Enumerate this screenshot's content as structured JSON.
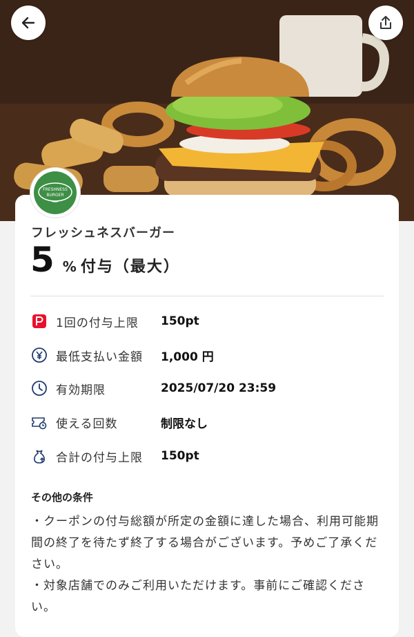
{
  "header": {
    "back_icon": "arrow-left-icon",
    "share_icon": "share-icon"
  },
  "shop": {
    "logo_text_line1": "FRESHNESS",
    "logo_text_line2": "BURGER",
    "name": "フレッシュネスバーガー"
  },
  "reward": {
    "rate": "5",
    "unit": "%",
    "text": "付与（最大）"
  },
  "details": [
    {
      "icon": "paypay-icon",
      "label": "1回の付与上限",
      "value": "150pt"
    },
    {
      "icon": "yen-icon",
      "label": "最低支払い金額",
      "value": "1,000 円"
    },
    {
      "icon": "clock-icon",
      "label": "有効期限",
      "value": "2025/07/20 23:59"
    },
    {
      "icon": "ticket-icon",
      "label": "使える回数",
      "value": "制限なし"
    },
    {
      "icon": "bag-icon",
      "label": "合計の付与上限",
      "value": "150pt"
    }
  ],
  "conditions": {
    "title": "その他の条件",
    "items": [
      "・クーポンの付与総額が所定の金額に達した場合、利用可能期間の終了を待たず終了する場合がございます。予めご了承ください。",
      "・対象店舗でのみご利用いただけます。事前にご確認ください。"
    ]
  },
  "colors": {
    "accent_red": "#e8112d",
    "icon_navy": "#1f3a6e",
    "logo_green": "#3d8f45"
  }
}
